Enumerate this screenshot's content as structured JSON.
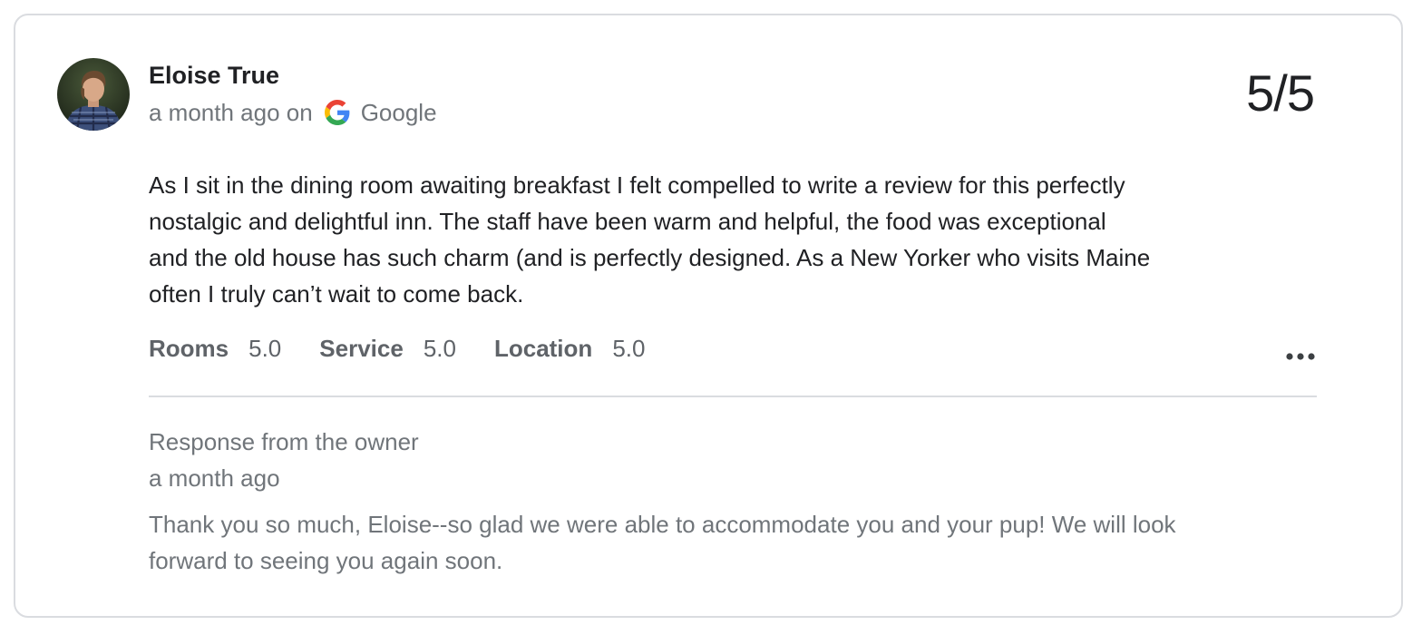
{
  "review": {
    "author_name": "Eloise True",
    "time_ago": "a month ago on",
    "source": "Google",
    "source_icon": "google-icon",
    "score": "5/5",
    "text_lines": [
      "As I sit in the dining room awaiting breakfast I felt compelled to write a review for this perfectly",
      "nostalgic and delightful inn. The staff have been warm and helpful, the food was exceptional",
      "and the old house has such charm (and is perfectly designed. As a New Yorker who visits Maine",
      "often I truly can’t wait to come back."
    ],
    "ratings": [
      {
        "label": "Rooms",
        "value": "5.0"
      },
      {
        "label": "Service",
        "value": "5.0"
      },
      {
        "label": "Location",
        "value": "5.0"
      }
    ],
    "more_icon": "more-horizontal-icon"
  },
  "owner_response": {
    "heading": "Response from the owner",
    "time_ago": "a month ago",
    "text_lines": [
      "Thank you so much, Eloise--so glad we were able to accommodate you and your pup! We will look",
      "forward to seeing you again soon."
    ]
  },
  "colors": {
    "primary_text": "#202124",
    "secondary_text": "#70757a",
    "rating_text": "#5f6368",
    "border": "#dadce0",
    "google_blue": "#4285F4",
    "google_red": "#EA4335",
    "google_yellow": "#FBBC05",
    "google_green": "#34A853"
  }
}
